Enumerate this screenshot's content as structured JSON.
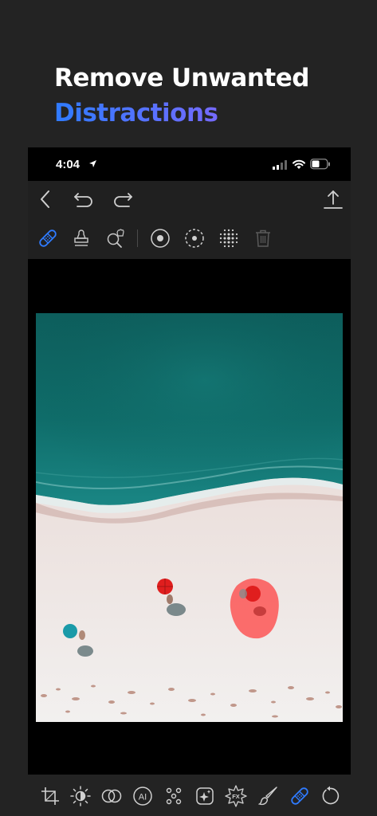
{
  "headline": {
    "line1": "Remove Unwanted",
    "line2": "Distractions"
  },
  "status_bar": {
    "time": "4:04"
  },
  "navbar": {
    "icons": [
      "back-icon",
      "undo-icon",
      "redo-icon",
      "share-icon"
    ]
  },
  "tool_row": {
    "icons": [
      "bandage-icon",
      "stamp-icon",
      "quick-select-icon",
      "brush-size-icon",
      "dashed-circle-icon",
      "halftone-icon",
      "trash-icon"
    ],
    "active": "bandage-icon"
  },
  "bottom_toolbar": {
    "icons": [
      "crop-icon",
      "adjust-icon",
      "blend-icon",
      "ai-icon",
      "dots-icon",
      "sparkle-icon",
      "fx-icon",
      "brush-icon",
      "bandage-icon",
      "reset-icon"
    ],
    "ai_label": "AI",
    "fx_label": "FX",
    "active": "bandage-icon"
  },
  "colors": {
    "background": "#232323",
    "accent_blue": "#2f7bff",
    "gradient_end": "#a25cf0",
    "mask_red": "#ff3b3b",
    "inactive_icon": "#c8c8c8"
  }
}
